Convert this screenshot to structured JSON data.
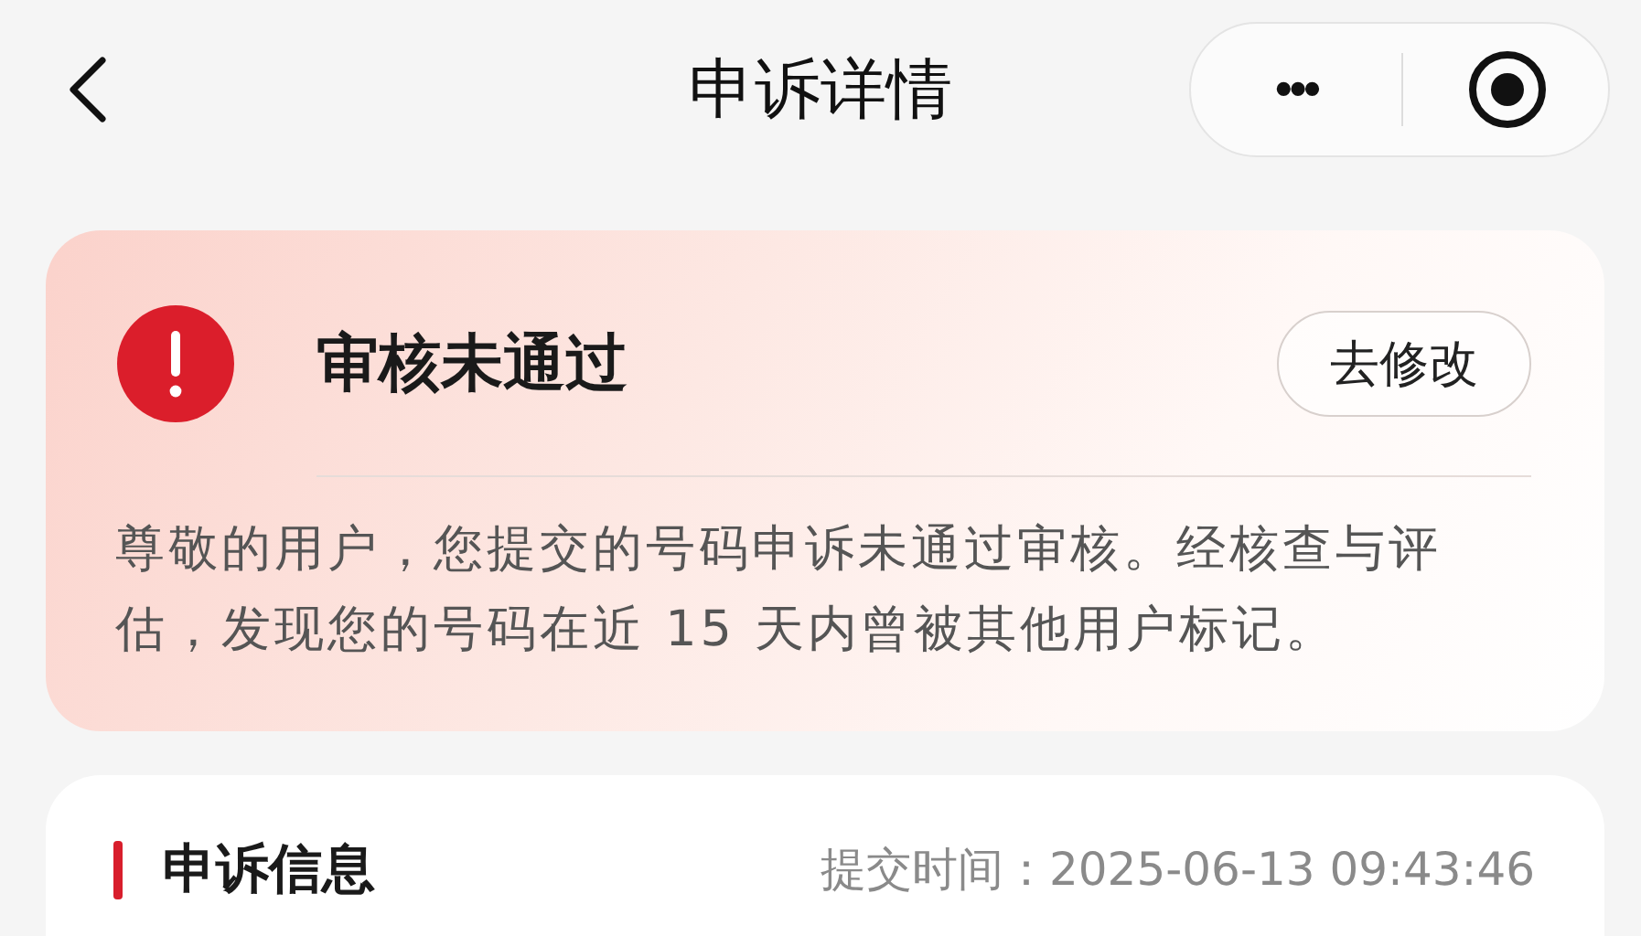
{
  "nav_bar": {
    "title": "申诉详情",
    "more_button": "•••"
  },
  "status_card": {
    "title": "审核未通过",
    "action_button": "去修改",
    "message": "尊敬的用户，您提交的号码申诉未通过审核。经核查与评估，发现您的号码在近 15 天内曾被其他用户标记。"
  },
  "info_card": {
    "title": "申诉信息",
    "submit_time_label": "提交时间：",
    "submit_time": "2025-06-13 09:43:46"
  }
}
